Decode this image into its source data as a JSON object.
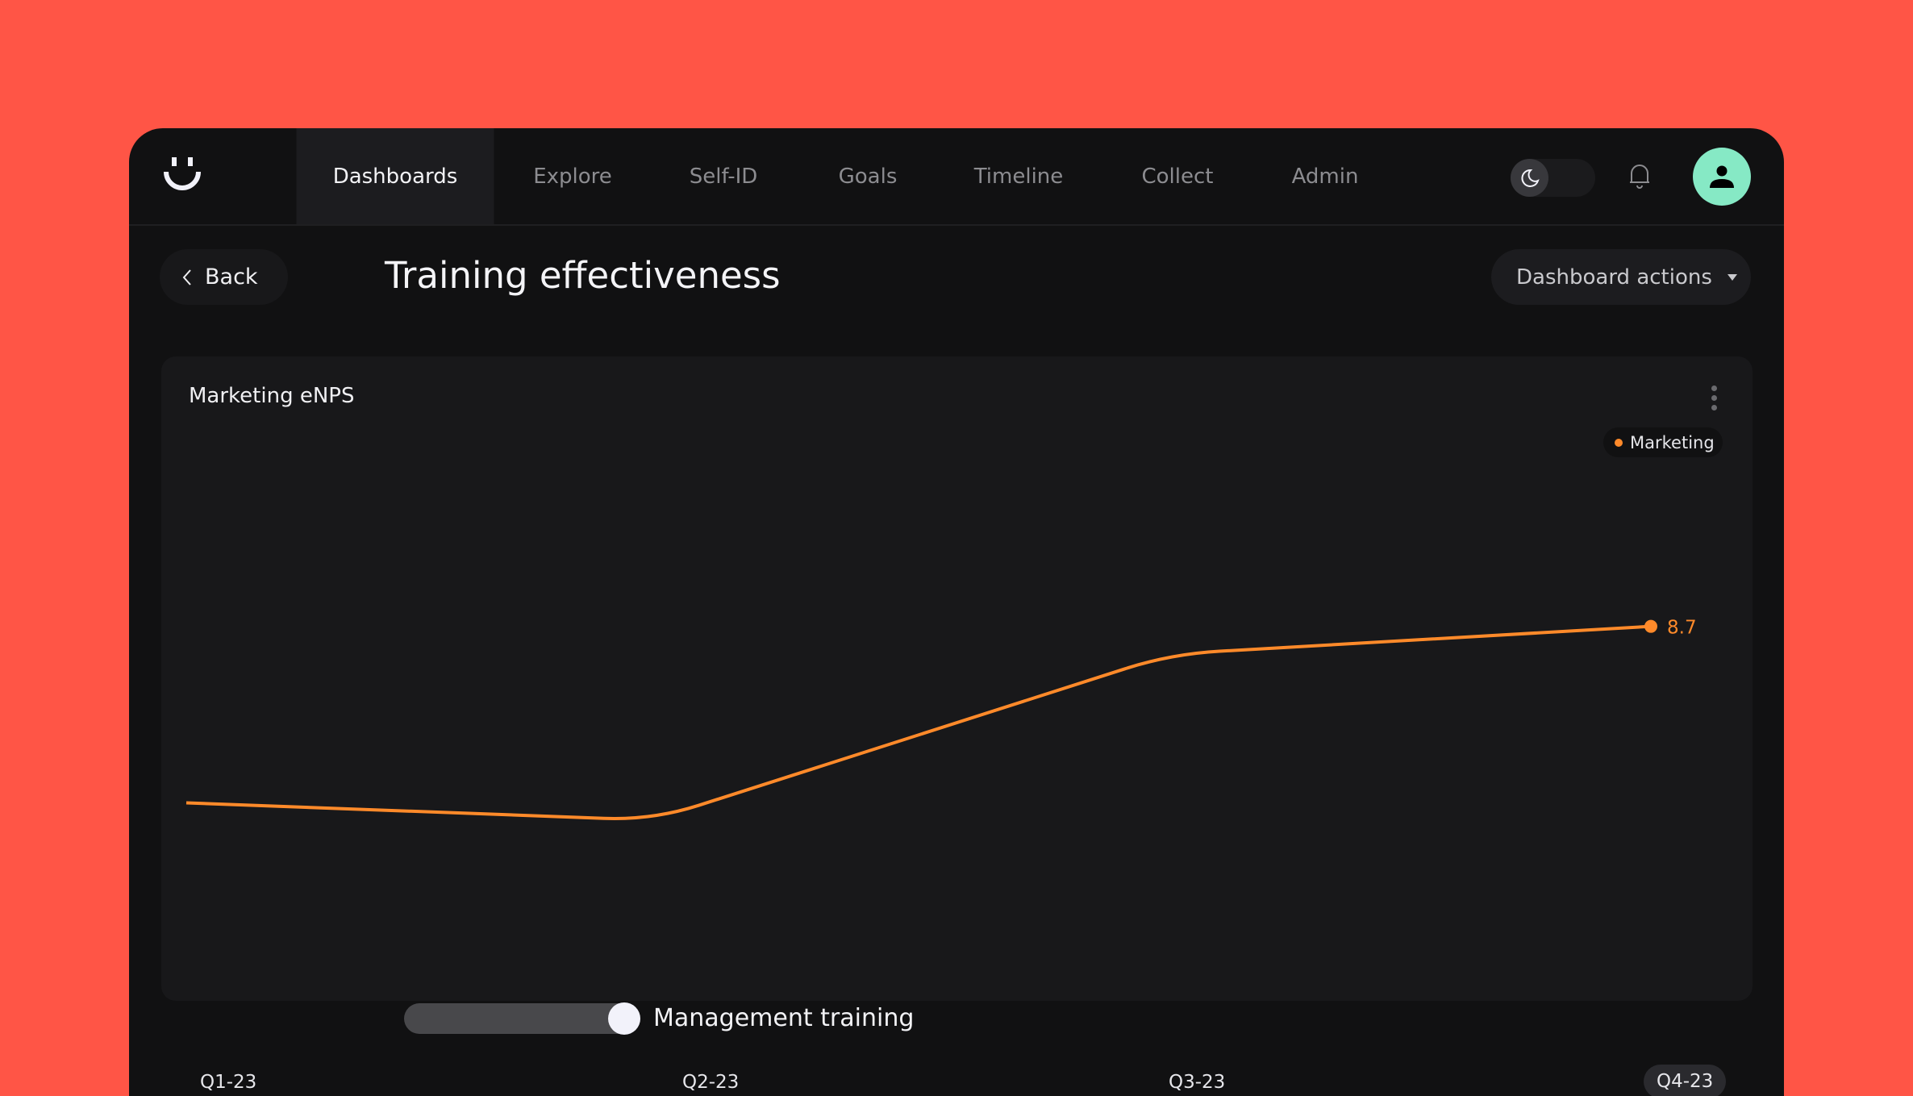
{
  "nav": {
    "tabs": [
      {
        "label": "Dashboards",
        "active": true
      },
      {
        "label": "Explore"
      },
      {
        "label": "Self-ID"
      },
      {
        "label": "Goals"
      },
      {
        "label": "Timeline"
      },
      {
        "label": "Collect"
      },
      {
        "label": "Admin"
      }
    ],
    "theme_toggle_icon": "moon-icon",
    "notification_icon": "bell-icon",
    "avatar_icon": "user-icon",
    "avatar_color": "#86e9c5"
  },
  "header": {
    "back_label": "Back",
    "title": "Training effectiveness",
    "actions_label": "Dashboard actions"
  },
  "card": {
    "title": "Marketing eNPS",
    "annotation": "Management training"
  },
  "chart_data": {
    "type": "line",
    "categories": [
      "Q1-23",
      "Q2-23",
      "Q3-23",
      "Q4-23"
    ],
    "series": [
      {
        "name": "Marketing",
        "values": [
          3.6,
          3.1,
          7.9,
          8.7
        ],
        "color": "#ff8a2a"
      }
    ],
    "data_labels": [
      {
        "index": 3,
        "text": "8.7"
      }
    ],
    "ylim": [
      0,
      13.4
    ],
    "grid": false,
    "legend": "top-right",
    "highlighted_category": "Q4-23"
  }
}
